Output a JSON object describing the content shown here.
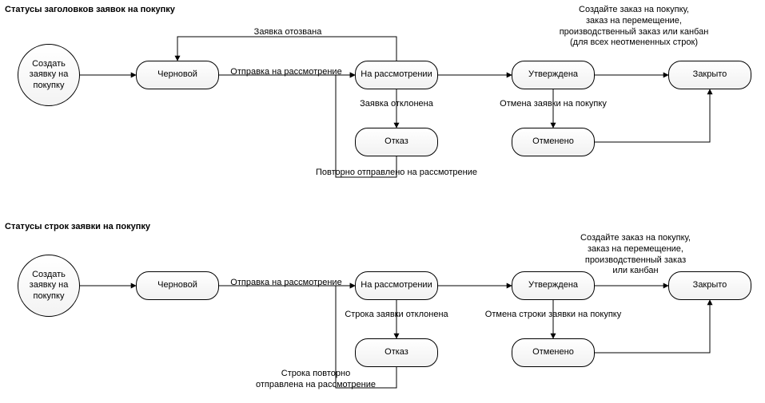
{
  "header": {
    "title": "Статусы заголовков заявок на покупку",
    "start": "Создать заявку на покупку",
    "nodes": {
      "draft": "Черновой",
      "review": "На рассмотрении",
      "approved": "Утверждена",
      "closed": "Закрыто",
      "rejected": "Отказ",
      "cancelled": "Отменено"
    },
    "edges": {
      "submit": "Отправка на рассмотрение",
      "recall": "Заявка отозвана",
      "reject": "Заявка отклонена",
      "resubmit": "Повторно отправлено на рассмотрение",
      "cancel": "Отмена заявки на покупку",
      "close": "Создайте заказ на покупку,\nзаказ на перемещение,\nпроизводственный заказ или канбан\n(для всех неотмененных строк)"
    }
  },
  "lines": {
    "title": "Статусы строк заявки на покупку",
    "start": "Создать заявку на покупку",
    "nodes": {
      "draft": "Черновой",
      "review": "На рассмотрении",
      "approved": "Утверждена",
      "closed": "Закрыто",
      "rejected": "Отказ",
      "cancelled": "Отменено"
    },
    "edges": {
      "submit": "Отправка на рассмотрение",
      "reject": "Строка заявки отклонена",
      "resubmit": "Строка повторно\nотправлена на рассмотрение",
      "cancel": "Отмена строки заявки на покупку",
      "close": "Создайте заказ на покупку,\nзаказ на перемещение,\nпроизводственный заказ\nили канбан"
    }
  }
}
